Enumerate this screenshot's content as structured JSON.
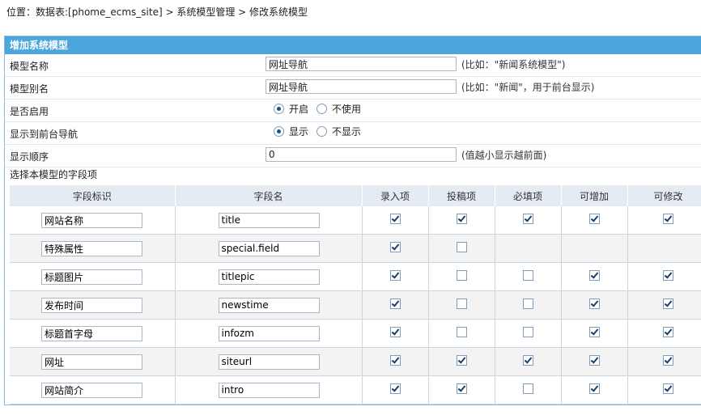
{
  "breadcrumb": {
    "position_label": "位置：",
    "table_part": "数据表:[phome_ecms_site]",
    "sep1": " > ",
    "link1": "系统模型管理",
    "sep2": " > ",
    "current": "修改系统模型"
  },
  "panel": {
    "title": "增加系统模型",
    "model_name": {
      "label": "模型名称",
      "value": "网址导航",
      "hint": "(比如：\"新闻系统模型\")"
    },
    "model_alias": {
      "label": "模型别名",
      "value": "网址导航",
      "hint": "(比如：\"新闻\"，用于前台显示)"
    },
    "enabled": {
      "label": "是否启用",
      "options": [
        "开启",
        "不使用"
      ],
      "selected": "开启"
    },
    "show_nav": {
      "label": "显示到前台导航",
      "options": [
        "显示",
        "不显示"
      ],
      "selected": "显示"
    },
    "order": {
      "label": "显示顺序",
      "value": "0",
      "hint": "(值越小显示越前面)"
    },
    "fields_label": "选择本模型的字段项"
  },
  "fields_table": {
    "headers": [
      "字段标识",
      "字段名",
      "录入项",
      "投稿项",
      "必填项",
      "可增加",
      "可修改"
    ],
    "rows": [
      {
        "ident": "网站名称",
        "name": "title",
        "checks": [
          true,
          true,
          true,
          true,
          true
        ]
      },
      {
        "ident": "特殊属性",
        "name": "special.field",
        "checks": [
          true,
          false,
          null,
          null,
          null
        ]
      },
      {
        "ident": "标题图片",
        "name": "titlepic",
        "checks": [
          true,
          false,
          false,
          true,
          true
        ]
      },
      {
        "ident": "发布时间",
        "name": "newstime",
        "checks": [
          true,
          false,
          false,
          true,
          true
        ]
      },
      {
        "ident": "标题首字母",
        "name": "infozm",
        "checks": [
          true,
          false,
          false,
          true,
          true
        ]
      },
      {
        "ident": "网址",
        "name": "siteurl",
        "checks": [
          true,
          true,
          true,
          true,
          true
        ]
      },
      {
        "ident": "网站简介",
        "name": "intro",
        "checks": [
          true,
          true,
          false,
          true,
          true
        ]
      }
    ]
  }
}
